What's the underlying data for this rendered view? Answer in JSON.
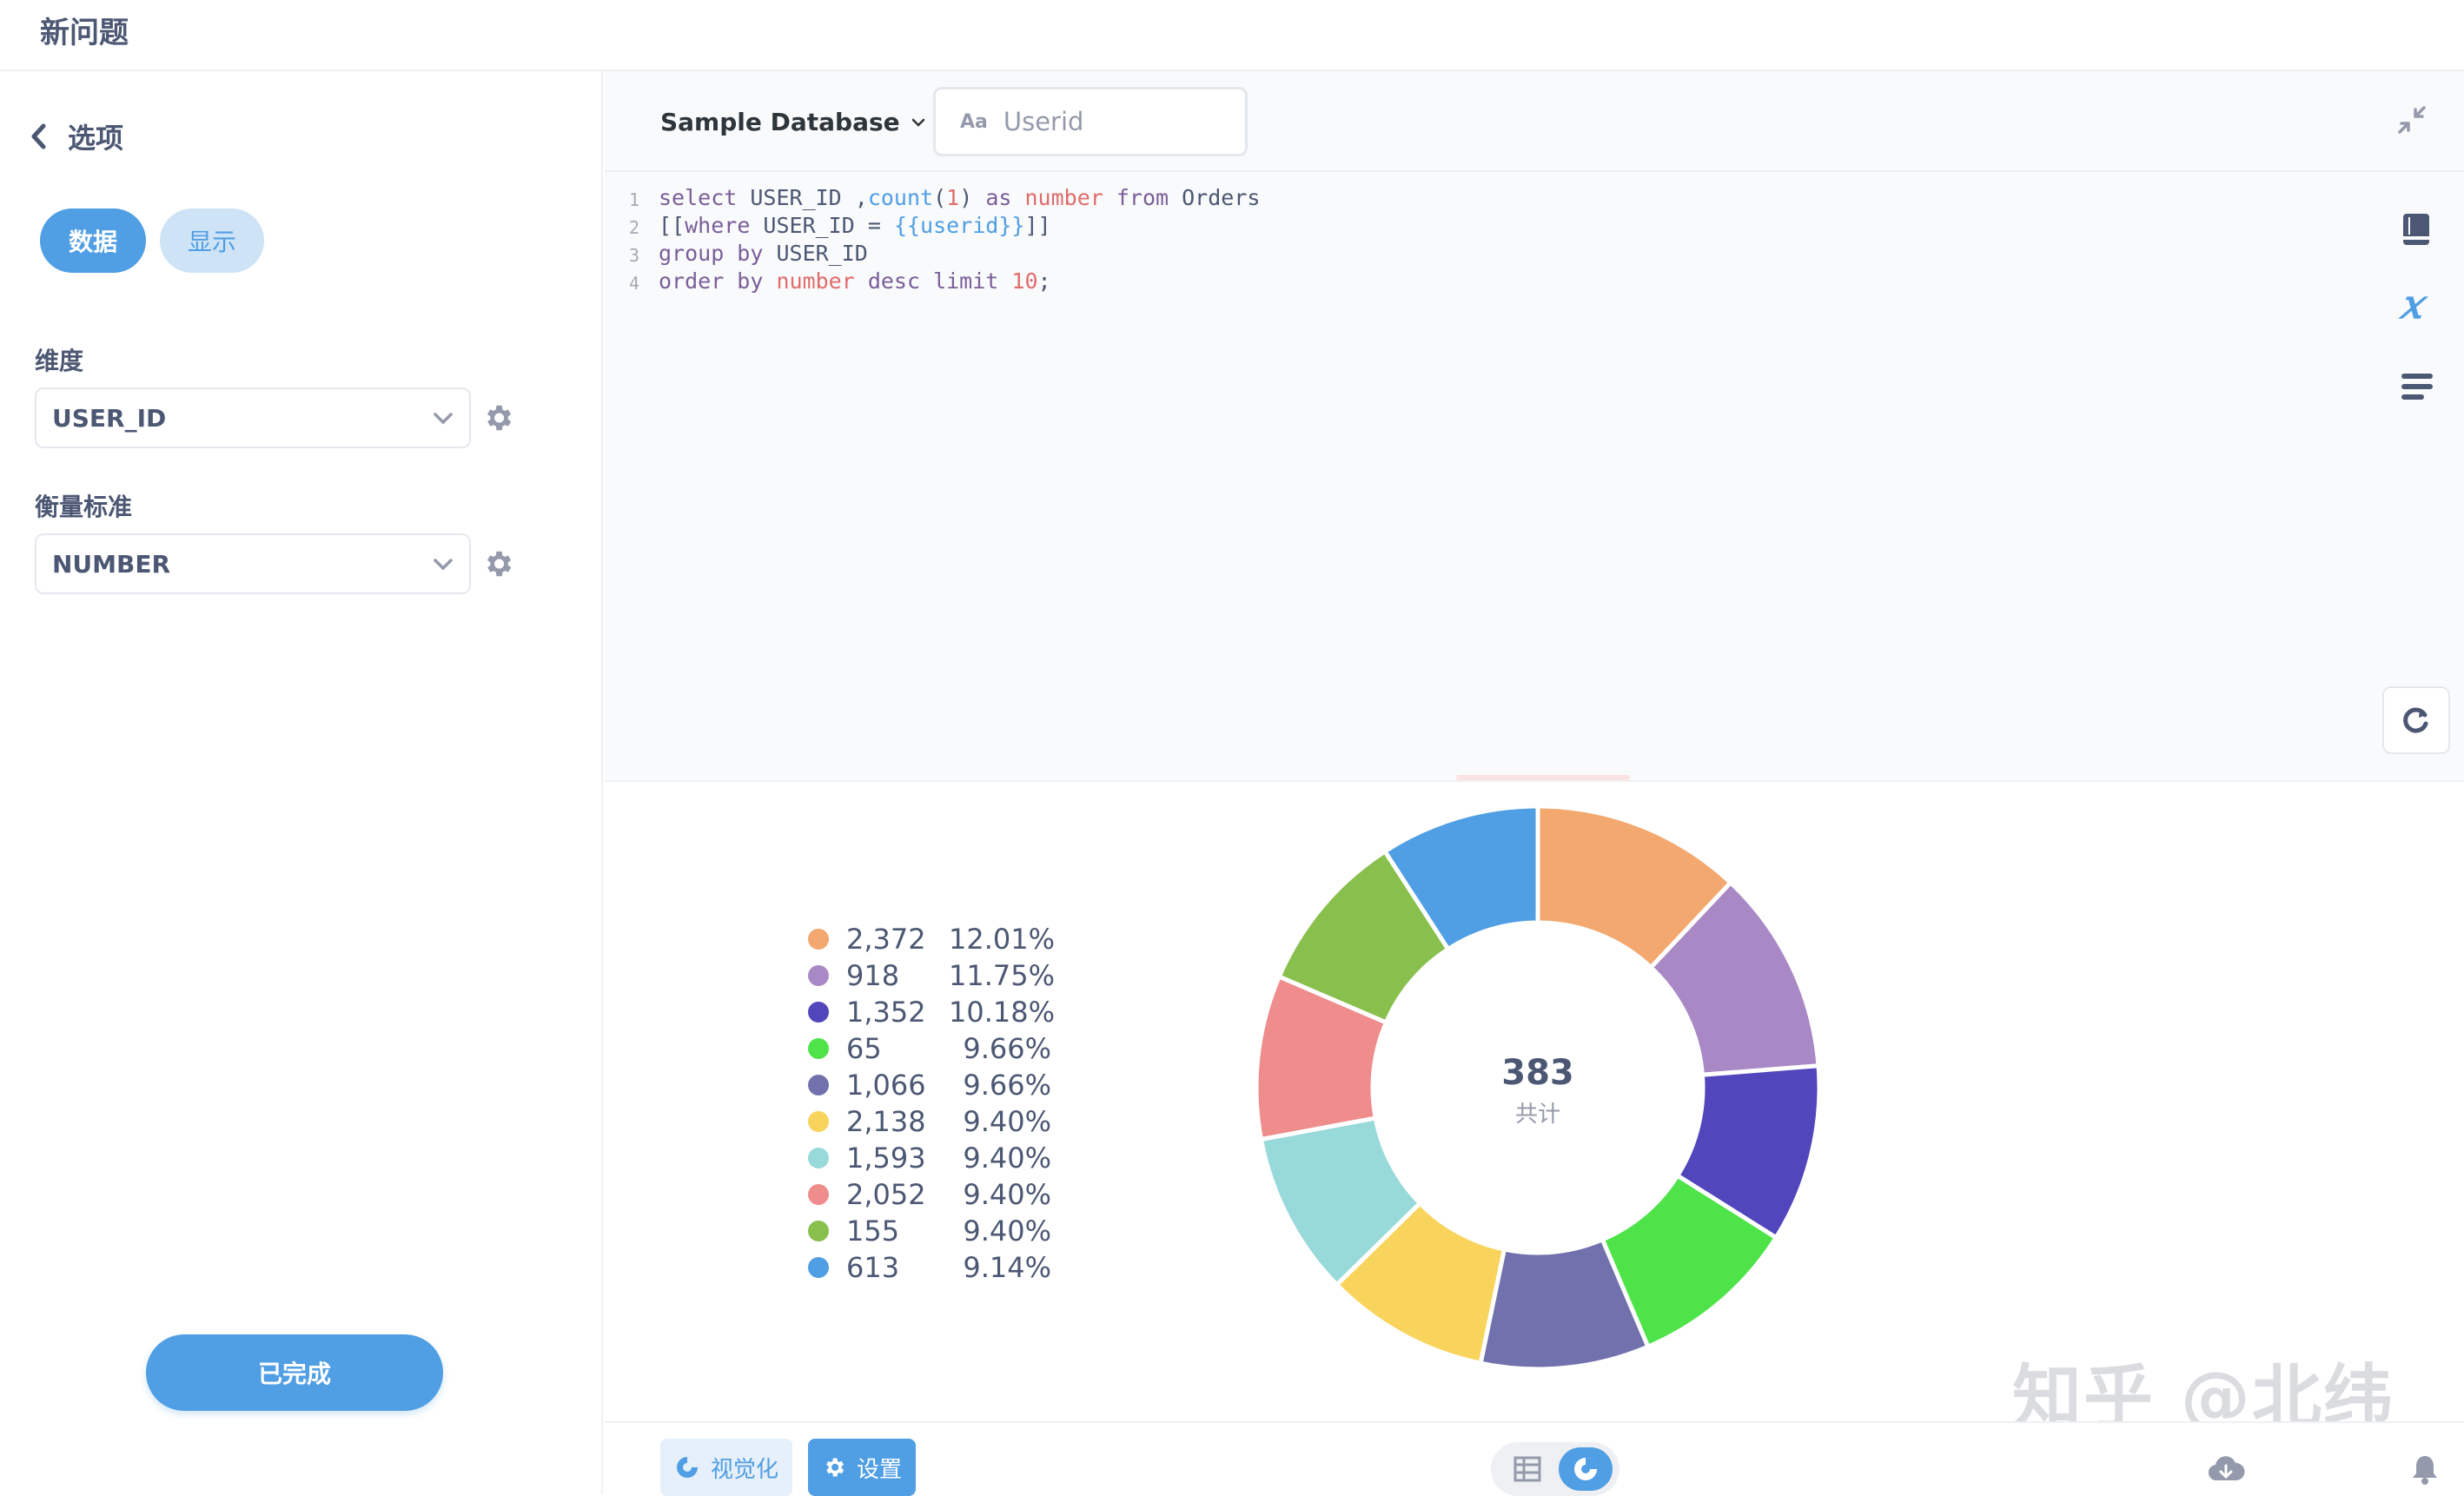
{
  "header": {
    "title": "新问题"
  },
  "sidebar": {
    "back_label": "选项",
    "tabs": [
      {
        "label": "数据"
      },
      {
        "label": "显示"
      }
    ],
    "dimension": {
      "label": "维度",
      "value": "USER_ID"
    },
    "metric": {
      "label": "衡量标准",
      "value": "NUMBER"
    },
    "done_label": "已完成"
  },
  "editor": {
    "database": "Sample Database",
    "variable": {
      "icon_text": "Aa",
      "value": "Userid"
    },
    "lines": [
      {
        "n": "1",
        "tokens": [
          {
            "t": "select ",
            "c": "kw"
          },
          {
            "t": "USER_ID ,",
            "c": "plain"
          },
          {
            "t": "count",
            "c": "fn"
          },
          {
            "t": "(",
            "c": "plain"
          },
          {
            "t": "1",
            "c": "num"
          },
          {
            "t": ") ",
            "c": "plain"
          },
          {
            "t": "as ",
            "c": "kw"
          },
          {
            "t": "number ",
            "c": "num"
          },
          {
            "t": "from ",
            "c": "kw"
          },
          {
            "t": "Orders",
            "c": "plain"
          }
        ]
      },
      {
        "n": "2",
        "tokens": [
          {
            "t": "[[",
            "c": "plain"
          },
          {
            "t": "where ",
            "c": "kw"
          },
          {
            "t": "USER_ID = ",
            "c": "plain"
          },
          {
            "t": "{{userid}}",
            "c": "vr"
          },
          {
            "t": "]]",
            "c": "plain"
          }
        ]
      },
      {
        "n": "3",
        "tokens": [
          {
            "t": "group by ",
            "c": "kw"
          },
          {
            "t": "USER_ID",
            "c": "plain"
          }
        ]
      },
      {
        "n": "4",
        "tokens": [
          {
            "t": "order by ",
            "c": "kw"
          },
          {
            "t": "number ",
            "c": "num"
          },
          {
            "t": "desc limit ",
            "c": "kw"
          },
          {
            "t": "10",
            "c": "num"
          },
          {
            "t": ";",
            "c": "plain"
          }
        ]
      }
    ]
  },
  "chart_data": {
    "type": "pie",
    "categories": [
      "2,372",
      "918",
      "1,352",
      "65",
      "1,066",
      "2,138",
      "1,593",
      "2,052",
      "155",
      "613"
    ],
    "percent_labels": [
      "12.01%",
      "11.75%",
      "10.18%",
      "9.66%",
      "9.66%",
      "9.40%",
      "9.40%",
      "9.40%",
      "9.40%",
      "9.14%"
    ],
    "values": [
      12.01,
      11.75,
      10.18,
      9.66,
      9.66,
      9.4,
      9.4,
      9.4,
      9.4,
      9.14
    ],
    "colors": [
      "#f2a86f",
      "#a989c5",
      "#5146bb",
      "#4fe34a",
      "#7172ad",
      "#f9d45c",
      "#98d9d9",
      "#ef8c8c",
      "#88bf4d",
      "#509ee3"
    ],
    "total": "383",
    "total_label": "共计",
    "legend_position": "left"
  },
  "footer": {
    "visualize_label": "视觉化",
    "settings_label": "设置"
  },
  "watermark": "知乎 @北纬"
}
